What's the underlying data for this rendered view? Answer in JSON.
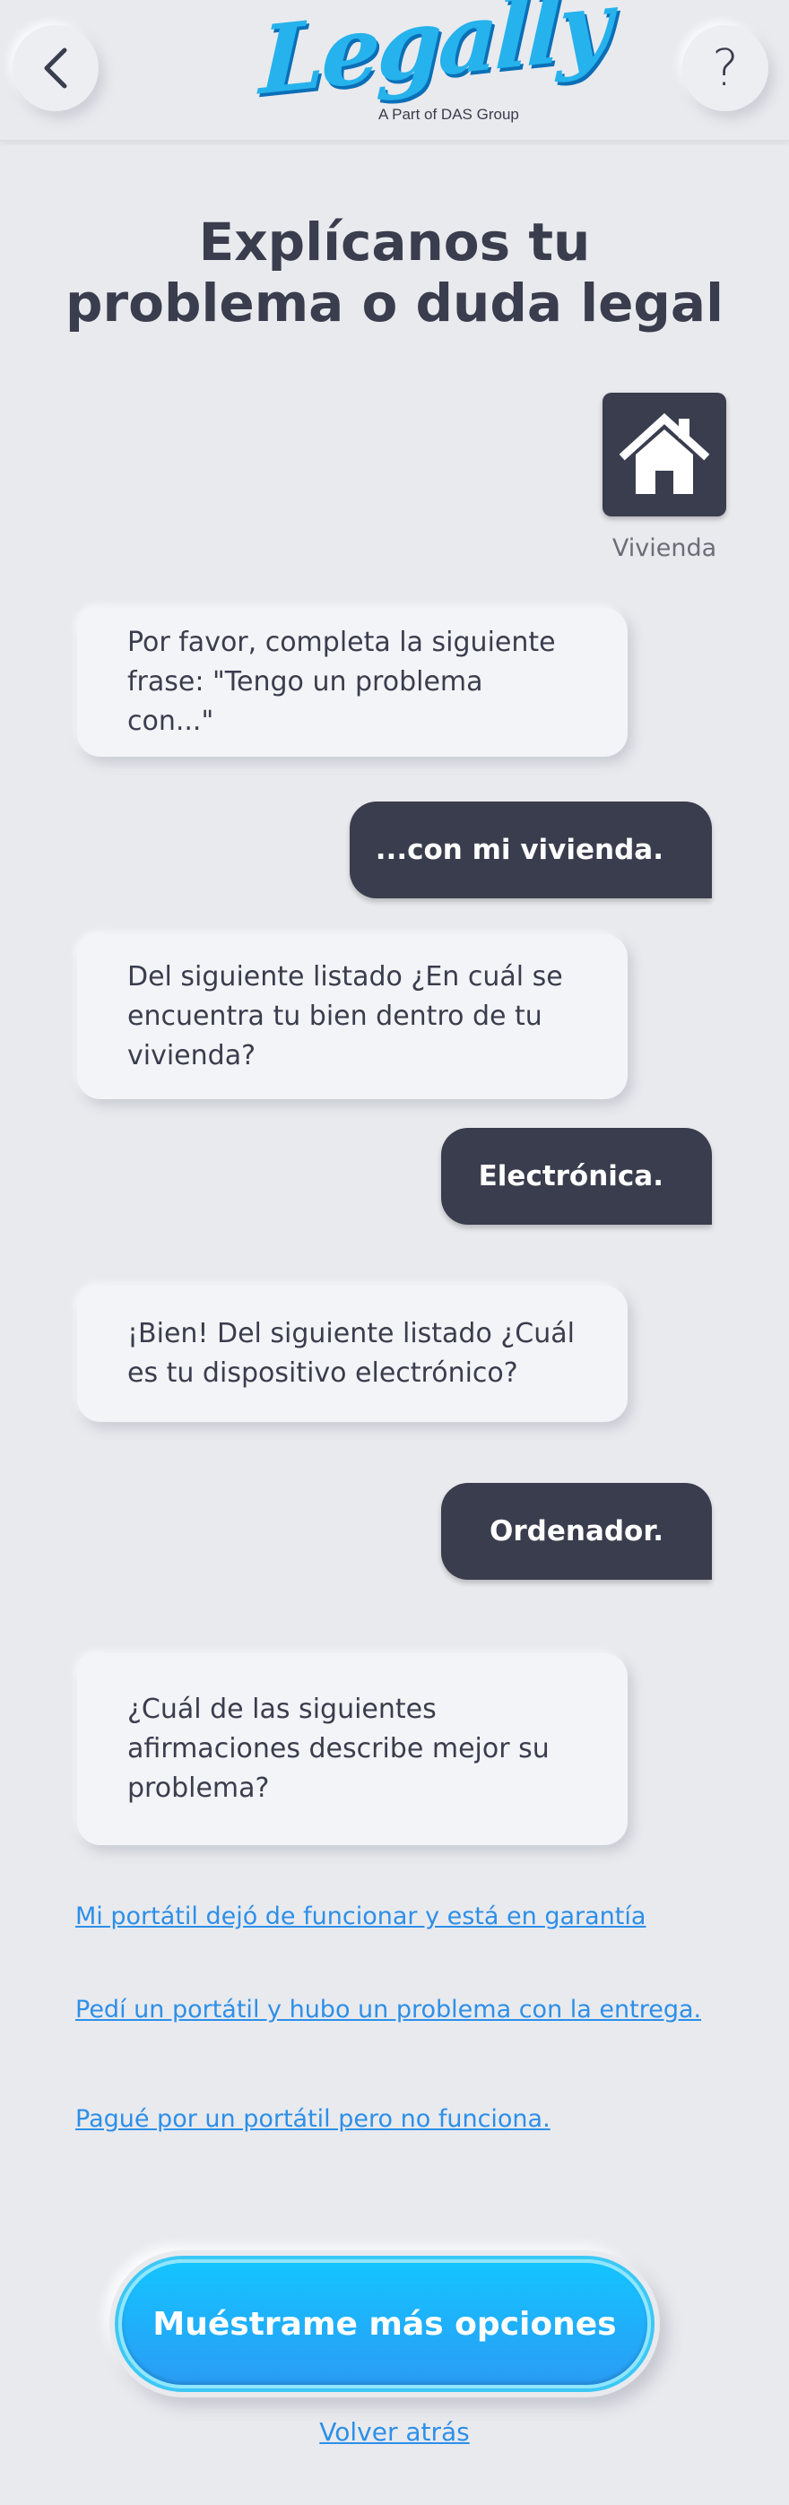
{
  "header": {
    "logo_text": "Legally",
    "logo_subtitle": "A Part of DAS Group",
    "help_label": "?"
  },
  "page_title": "Explícanos tu problema o duda legal",
  "category": {
    "label": "Vivienda",
    "icon": "house-icon"
  },
  "conversation": [
    {
      "from": "bot",
      "text": "Por favor, completa la siguiente frase: \"Tengo un problema con...\""
    },
    {
      "from": "user",
      "text": "...con mi vivienda."
    },
    {
      "from": "bot",
      "text": "Del siguiente listado ¿En cuál se encuentra tu bien dentro de tu vivienda?"
    },
    {
      "from": "user",
      "text": "Electrónica."
    },
    {
      "from": "bot",
      "text": "¡Bien! Del siguiente listado ¿Cuál es tu dispositivo electrónico?"
    },
    {
      "from": "user",
      "text": "Ordenador."
    },
    {
      "from": "bot",
      "text": "¿Cuál de las siguientes afirmaciones describe mejor su problema?"
    }
  ],
  "options": [
    "Mi portátil dejó de funcionar y está en garantía",
    "Pedí un portátil y hubo un problema con la entrega.",
    "Pagué por un portátil pero no funciona."
  ],
  "cta_label": "Muéstrame más opciones",
  "back_link": "Volver atrás",
  "colors": {
    "background": "#e9eaee",
    "dark": "#3a3d4d",
    "link": "#2d8fe8",
    "cta": "#14c4ff",
    "logo": "#26b2ec"
  }
}
